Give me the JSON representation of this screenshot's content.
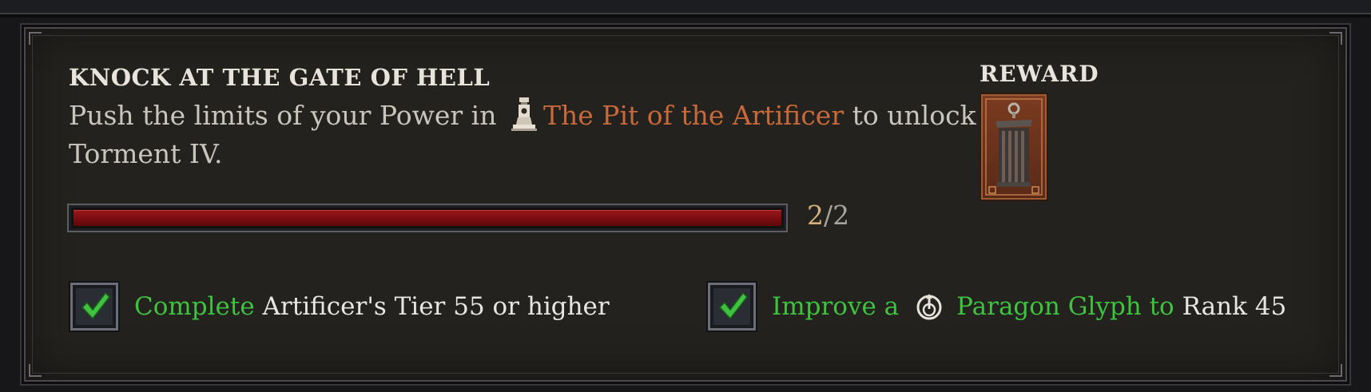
{
  "challenge": {
    "title": "KNOCK AT THE GATE OF HELL",
    "description_pre": "Push the limits of your Power in ",
    "pit_icon": "pit-obelisk-icon",
    "location_link": "The Pit of the Artificer",
    "description_post": " to unlock Torment IV."
  },
  "progress": {
    "current": "2",
    "separator": "/",
    "total": "2",
    "fill_fraction": 1.0,
    "fill_color": "#8a1215"
  },
  "objectives": [
    {
      "checked": true,
      "verb": "Complete",
      "rest": "Artificer's Tier 55 or higher"
    },
    {
      "checked": true,
      "verb": "Improve a",
      "icon": "paragon-glyph-icon",
      "green_text": "Paragon Glyph to",
      "rest": "Rank 45"
    }
  ],
  "reward": {
    "label": "REWARD",
    "icon": "cage-reward-icon"
  },
  "colors": {
    "accent_orange": "#c8693a",
    "accent_green": "#3fc23f",
    "progress_text": "#d2b07a"
  }
}
